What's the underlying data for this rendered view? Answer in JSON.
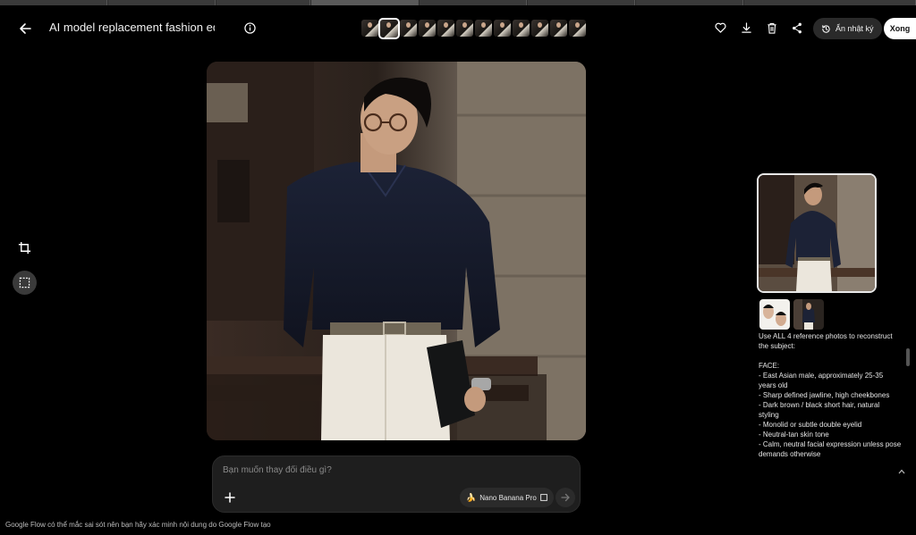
{
  "header": {
    "back_icon": "arrow-left-icon",
    "title": "AI model replacement fashion edi...",
    "info_icon": "info-icon",
    "actions": {
      "favorite_icon": "heart-icon",
      "download_icon": "download-icon",
      "delete_icon": "trash-icon",
      "share_icon": "share-icon",
      "hide_history_label": "Ẩn nhật ký",
      "hide_history_icon": "history-icon",
      "done_label": "Xong"
    }
  },
  "filmstrip": {
    "count": 12,
    "active_index": 1
  },
  "tools": [
    {
      "name": "crop-icon",
      "selected": false
    },
    {
      "name": "select-region-icon",
      "selected": true
    }
  ],
  "prompt_bar": {
    "placeholder": "Bạn muốn thay đổi điều gì?",
    "add_icon": "plus-icon",
    "model_label": "Nano Banana Pro",
    "model_icon": "banana-icon",
    "send_icon": "arrow-right-icon"
  },
  "side_panel": {
    "prompt_text": "Use ALL 4 reference photos to reconstruct the subject:\n\nFACE:\n- East Asian male, approximately 25-35 years old\n- Sharp defined jawline, high cheekbones\n- Dark brown / black short hair, natural styling\n- Monolid or subtle double eyelid\n- Neutral-tan skin tone\n- Calm, neutral facial expression unless pose demands otherwise"
  },
  "footer": {
    "disclaimer": "Google Flow có thể mắc sai sót nên bạn hãy xác minh nội dung do Google Flow tạo"
  },
  "colors": {
    "background": "#000000",
    "surface": "#1e1e1e",
    "chip": "#2b2b2b",
    "primary_button": "#ffffff"
  }
}
